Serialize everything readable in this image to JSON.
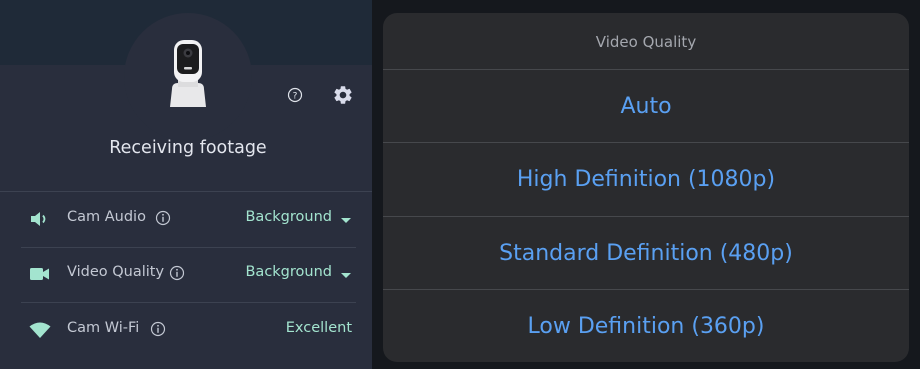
{
  "camera": {
    "status": "Receiving footage"
  },
  "header_icons": {
    "help_icon": "question-circle-icon",
    "settings_icon": "gear-icon"
  },
  "settings_rows": [
    {
      "icon": "speaker-icon",
      "label": "Cam Audio",
      "value": "Background",
      "dropdown": true
    },
    {
      "icon": "video-camera-icon",
      "label": "Video Quality",
      "value": "Background",
      "dropdown": true
    },
    {
      "icon": "wifi-icon",
      "label": "Cam Wi-Fi",
      "value": "Excellent",
      "dropdown": false
    }
  ],
  "video_quality_sheet": {
    "title": "Video Quality",
    "options": [
      "Auto",
      "High Definition (1080p)",
      "Standard Definition (480p)",
      "Low Definition (360p)"
    ]
  },
  "colors": {
    "accent_teal": "#a3e4cf",
    "option_blue": "#5aa0f2",
    "panel_bg": "#292e3d",
    "sheet_bg": "#2a2b2e"
  }
}
